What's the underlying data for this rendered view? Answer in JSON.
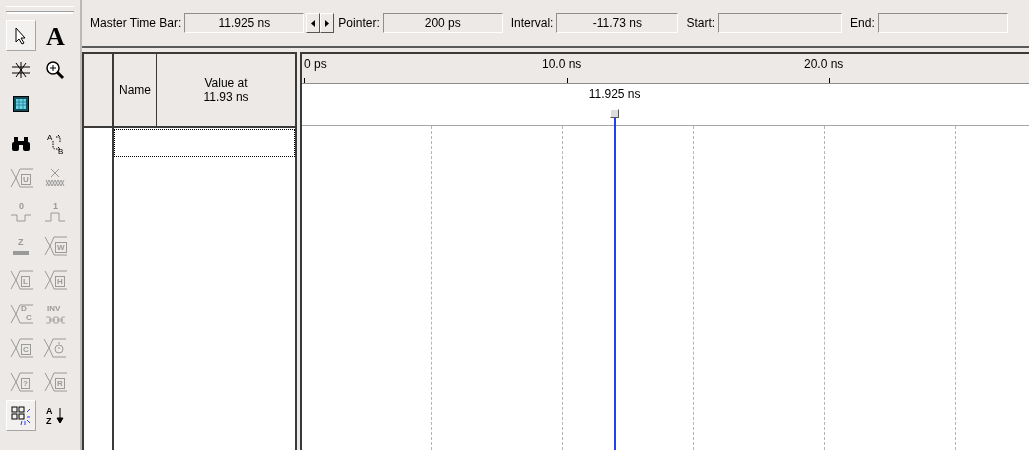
{
  "toolbar": {
    "rows": [
      [
        {
          "kind": "pointer",
          "selected": true,
          "disabled": false
        },
        {
          "kind": "letter",
          "glyphs": [
            "A"
          ],
          "selected": false,
          "disabled": false
        }
      ],
      [
        {
          "kind": "zoom-fit",
          "selected": false,
          "disabled": false
        },
        {
          "kind": "zoom",
          "selected": false,
          "disabled": false
        }
      ],
      [
        {
          "kind": "waveform-window",
          "selected": false,
          "disabled": false
        }
      ],
      [
        {
          "kind": "find",
          "selected": false,
          "disabled": false
        },
        {
          "kind": "replace",
          "glyphs": [
            "A",
            "B"
          ],
          "selected": false,
          "disabled": false
        }
      ],
      [
        {
          "kind": "value",
          "glyphs": [
            "U"
          ],
          "selected": false,
          "disabled": true
        },
        {
          "kind": "dont-care",
          "selected": false,
          "disabled": true
        }
      ],
      [
        {
          "kind": "pulse-low",
          "glyphs": [
            "0"
          ],
          "selected": false,
          "disabled": true
        },
        {
          "kind": "pulse-high",
          "glyphs": [
            "1"
          ],
          "selected": false,
          "disabled": true
        }
      ],
      [
        {
          "kind": "high-z",
          "glyphs": [
            "Z"
          ],
          "selected": false,
          "disabled": true
        },
        {
          "kind": "value",
          "glyphs": [
            "W"
          ],
          "selected": false,
          "disabled": true
        }
      ],
      [
        {
          "kind": "value",
          "glyphs": [
            "L"
          ],
          "selected": false,
          "disabled": true
        },
        {
          "kind": "value",
          "glyphs": [
            "H"
          ],
          "selected": false,
          "disabled": true
        }
      ],
      [
        {
          "kind": "value",
          "glyphs": [
            "D",
            "C"
          ],
          "selected": false,
          "disabled": true
        },
        {
          "kind": "invert",
          "glyphs": [
            "INV"
          ],
          "selected": false,
          "disabled": true
        }
      ],
      [
        {
          "kind": "value",
          "glyphs": [
            "C"
          ],
          "selected": false,
          "disabled": true
        },
        {
          "kind": "clock",
          "selected": false,
          "disabled": true
        }
      ],
      [
        {
          "kind": "value",
          "glyphs": [
            "?"
          ],
          "selected": false,
          "disabled": true
        },
        {
          "kind": "value",
          "glyphs": [
            "R"
          ],
          "selected": false,
          "disabled": true
        }
      ],
      [
        {
          "kind": "snap",
          "selected": true,
          "disabled": false
        },
        {
          "kind": "sort",
          "glyphs": [
            "A",
            "Z"
          ],
          "selected": false,
          "disabled": false
        }
      ]
    ]
  },
  "time_bar": {
    "fields": [
      {
        "label": "Master Time Bar:",
        "value": "11.925 ns",
        "kind": "master"
      },
      {
        "label": "Pointer:",
        "value": "200 ps"
      },
      {
        "label": "Interval:",
        "value": "-11.73 ns"
      },
      {
        "label": "Start:"
      },
      {
        "label": "End:"
      }
    ]
  },
  "signal_table": {
    "columns": [
      "Name",
      "Value at\n11.93 ns"
    ]
  },
  "waveform": {
    "ruler": [
      "0 ps",
      "10.0 ns",
      "20.0 ns"
    ],
    "master_marker": {
      "label": "11.925 ns",
      "level": 0.43
    }
  }
}
